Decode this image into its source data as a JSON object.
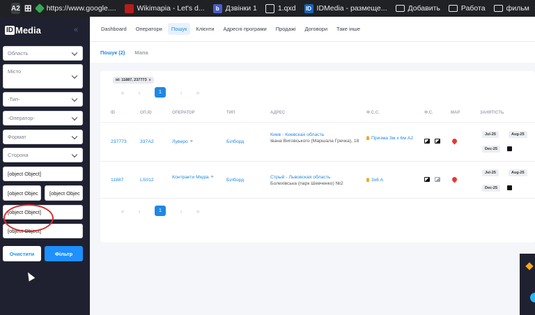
{
  "bookmarks": {
    "ext_a2": "A2",
    "items": [
      {
        "label": "https://www.google...."
      },
      {
        "label": "Wikimapia - Let's d..."
      },
      {
        "label": "Дзвінки 1"
      },
      {
        "label": "1.qxd"
      },
      {
        "label": "IDMedia - размеще..."
      },
      {
        "label": "Добавить"
      },
      {
        "label": "Работа"
      },
      {
        "label": "фильм"
      }
    ]
  },
  "sidebar": {
    "logo_box": "ID",
    "logo_text": "Media",
    "collapse": "«",
    "fields": [
      {
        "label": "Область"
      },
      {
        "label": "Місто"
      },
      {
        "label": "-Тип-"
      },
      {
        "label": "-Оператор-"
      },
      {
        "label": "Формат"
      },
      {
        "label": "Сторона"
      },
      {
        "label": "[object Object]"
      },
      {
        "label": "[object Objec"
      },
      {
        "label": "[object Objec"
      },
      {
        "label": "[object Object]"
      },
      {
        "label": "[object Object]"
      }
    ],
    "clear_label": "Очистити",
    "filter_label": "Фільтр"
  },
  "nav": {
    "items": [
      "Dashboard",
      "Оператори",
      "Пошук",
      "Клієнти",
      "Адресні програми",
      "Продажі",
      "Договори",
      "Таке інше"
    ]
  },
  "subtabs": [
    "Пошук (2)",
    "Мапа"
  ],
  "search": {
    "chip": "id: 11887, 237773",
    "chip_close": "x",
    "pager": {
      "first": "«",
      "prev": "‹",
      "page": "1",
      "next": "›",
      "last": "»"
    }
  },
  "table": {
    "headers": [
      "ID",
      "ОП.ID",
      "ОПЕРАТОР",
      "ТИП",
      "АДРЕС",
      "Ф.С.С.",
      "Ф.С.",
      "МАР",
      "ЗАНЯТІСТЬ"
    ],
    "rows": [
      {
        "id": "237773",
        "op_id": "337A2",
        "operator": "Луверо",
        "type": "Білборд",
        "city": "Киев - Киевская область",
        "address": "Івана Виговського (Маршала Гречка), 18",
        "fss": "Призма 3м х 6м A2",
        "badges": [
          "Jul-25",
          "Aug-25",
          "Dec-25"
        ]
      },
      {
        "id": "11887",
        "op_id": "LS012",
        "operator": "Контракти Медіа",
        "type": "Білборд",
        "city": "Стрый - Львовская область",
        "address": "Болехівська (парк Шевченко) №2",
        "fss": "3x6 A",
        "badges": [
          "Jul-25",
          "Aug-25",
          "Dec-25"
        ]
      }
    ]
  }
}
